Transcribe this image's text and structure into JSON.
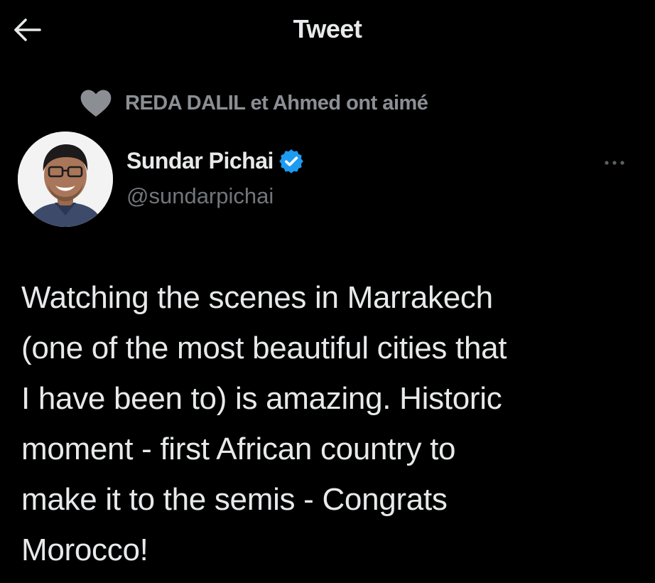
{
  "header": {
    "back_icon": "arrow-left-icon",
    "title": "Tweet"
  },
  "social_context": {
    "icon": "heart-icon",
    "names": "REDA DALIL",
    "rest": " et Ahmed ont aimé"
  },
  "author": {
    "name": "Sundar Pichai",
    "verified_icon": "verified-badge-icon",
    "handle": "@sundarpichai",
    "avatar_icon": "avatar-photo"
  },
  "more_icon": "more-dots-icon",
  "tweet": {
    "lines": [
      "Watching the scenes in Marrakech",
      "(one of the most beautiful cities that",
      "I have been to) is amazing. Historic",
      "moment - first African country to",
      "make it to the semis - Congrats",
      "Morocco!"
    ]
  },
  "colors": {
    "background": "#000000",
    "text_primary": "#e7e9ea",
    "text_secondary": "#71767b",
    "verified": "#1d9bf0"
  }
}
